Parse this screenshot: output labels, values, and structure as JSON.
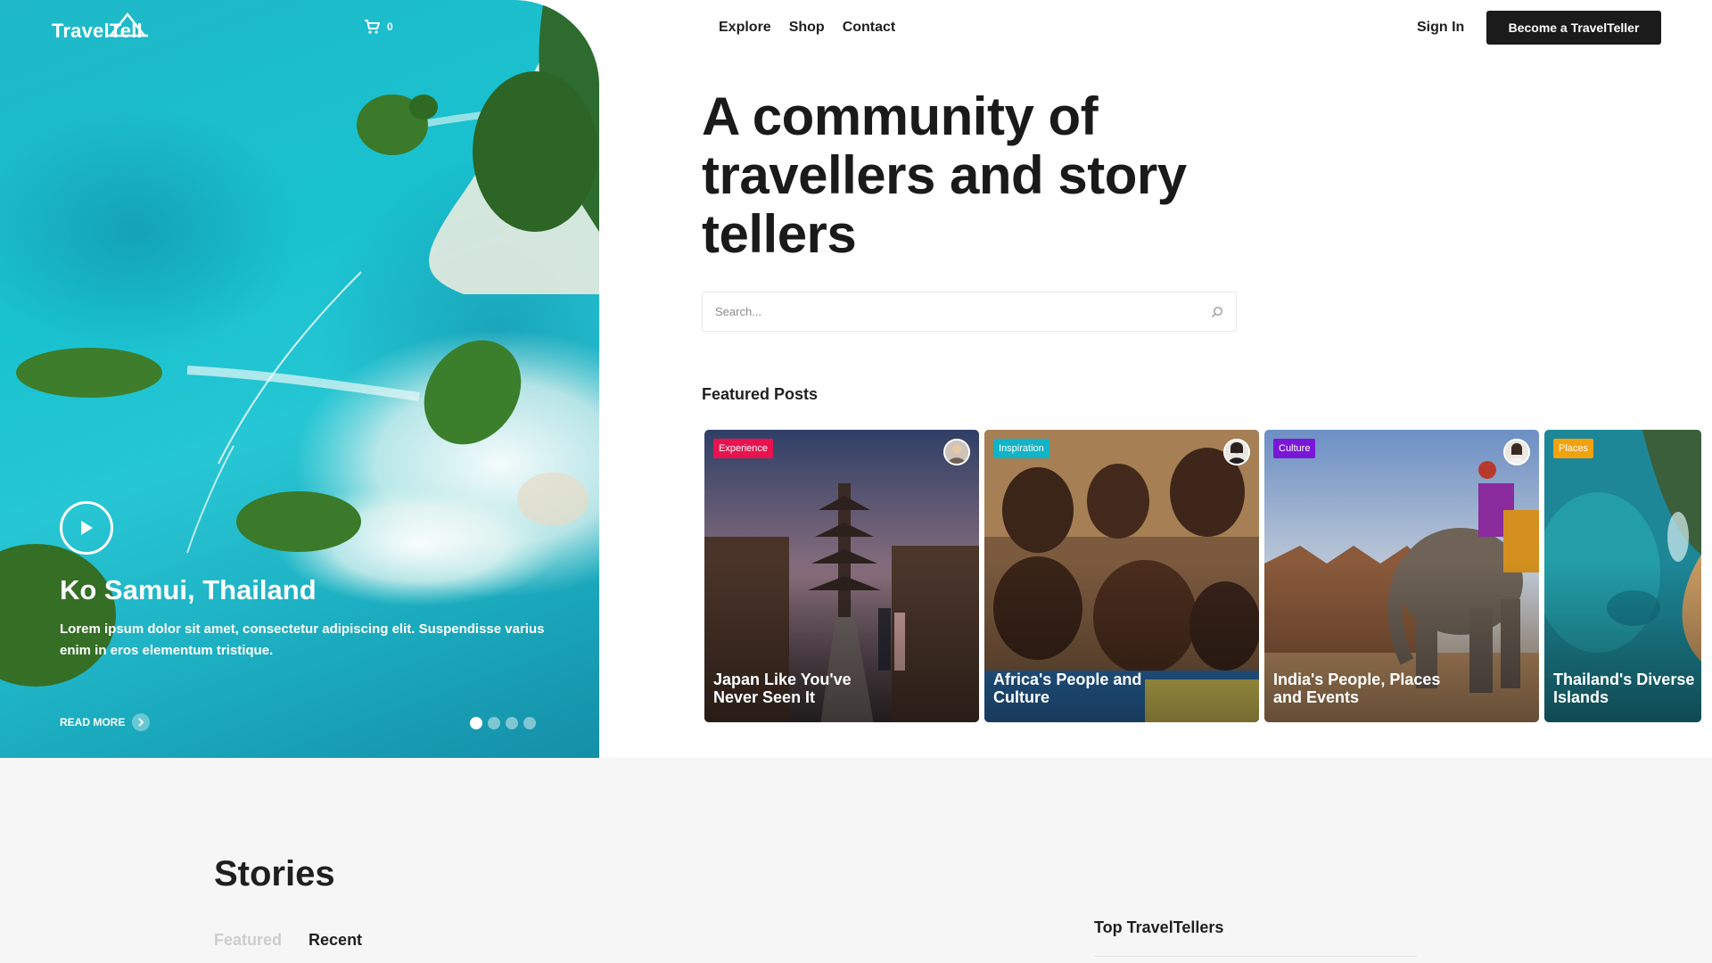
{
  "brand": {
    "name": "TravelTell"
  },
  "cart": {
    "count": "0"
  },
  "nav": {
    "items": [
      "Explore",
      "Shop",
      "Contact"
    ]
  },
  "auth": {
    "sign_in": "Sign In",
    "cta": "Become a TravelTeller"
  },
  "hero": {
    "title": "Ko Samui, Thailand",
    "text": "Lorem ipsum dolor sit amet, consectetur adipiscing elit. Suspendisse varius enim in eros elementum tristique.",
    "read_more": "READ MORE",
    "slides": 4,
    "active_slide": 1
  },
  "headline": "A community of travellers and story tellers",
  "search": {
    "placeholder": "Search...",
    "value": ""
  },
  "featured": {
    "heading": "Featured Posts",
    "posts": [
      {
        "tag": "Experience",
        "tag_color": "#e8124f",
        "title": "Japan Like You've Never Seen It",
        "has_avatar": true
      },
      {
        "tag": "Inspiration",
        "tag_color": "#11b4c6",
        "title": "Africa's People and Culture",
        "has_avatar": true
      },
      {
        "tag": "Culture",
        "tag_color": "#7a17d6",
        "title": "India's People, Places and Events",
        "has_avatar": true
      },
      {
        "tag": "Places",
        "tag_color": "#f2a20d",
        "title": "Thailand's Diverse Islands",
        "has_avatar": false
      }
    ]
  },
  "stories": {
    "title": "Stories",
    "tabs": [
      "Featured",
      "Recent"
    ],
    "active_tab": "Recent"
  },
  "sidebar": {
    "top_tellers": "Top TravelTellers"
  },
  "colors": {
    "accent_dark": "#1b1b1b",
    "hero_sea": "#1fb8c8",
    "lower_bg": "#f6f6f6"
  }
}
